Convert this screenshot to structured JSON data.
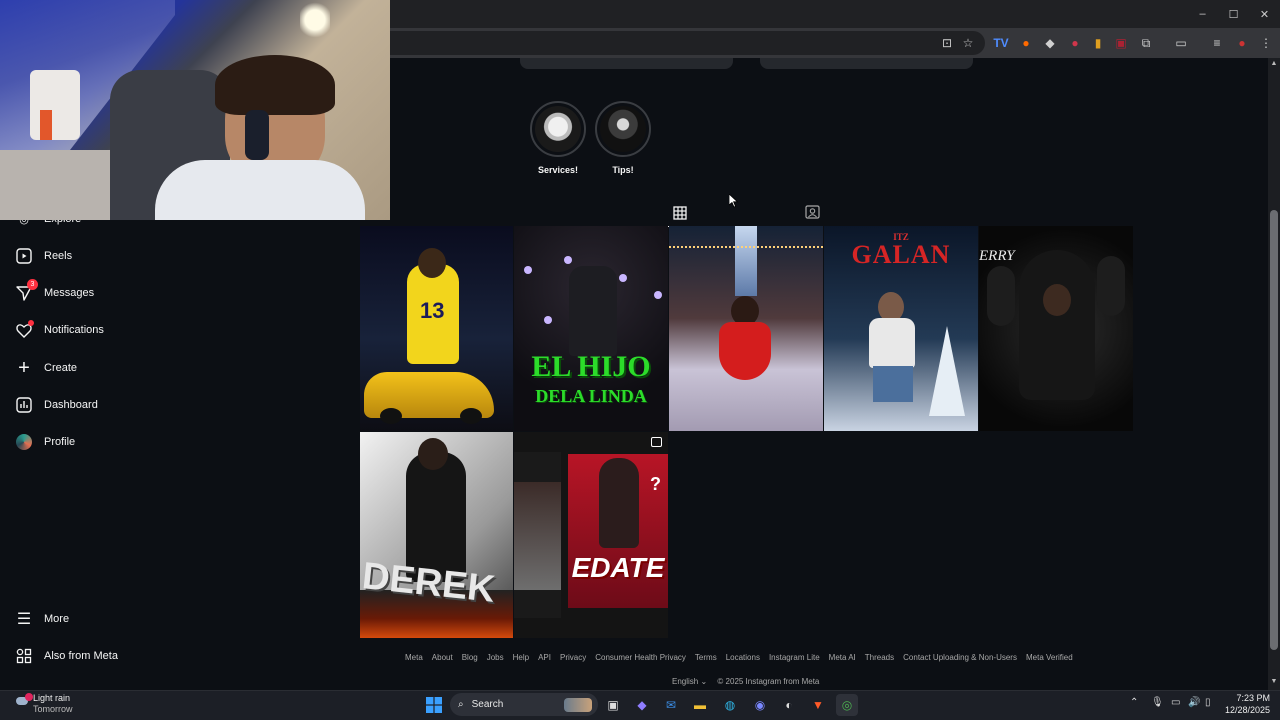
{
  "browser": {
    "window_controls": [
      "–",
      "☐",
      "✕"
    ]
  },
  "highlights": [
    {
      "label": "Services!"
    },
    {
      "label": "Tips!"
    }
  ],
  "sidebar": {
    "items": [
      {
        "label": "Explore",
        "icon": "compass-icon"
      },
      {
        "label": "Reels",
        "icon": "reels-icon"
      },
      {
        "label": "Messages",
        "icon": "messenger-icon",
        "badge": "3"
      },
      {
        "label": "Notifications",
        "icon": "heart-icon"
      },
      {
        "label": "Create",
        "icon": "plus-icon"
      },
      {
        "label": "Dashboard",
        "icon": "chart-icon"
      },
      {
        "label": "Profile",
        "icon": "avatar-icon"
      }
    ],
    "bottom": [
      {
        "label": "More",
        "icon": "menu-icon"
      },
      {
        "label": "Also from Meta",
        "icon": "meta-apps-icon"
      }
    ]
  },
  "posts": [
    {
      "name": "post-yellow-car",
      "text": "13"
    },
    {
      "name": "post-el-hijo",
      "text": "EL HIJO",
      "subtext": "DELA LINDA"
    },
    {
      "name": "post-red-dress",
      "text": ""
    },
    {
      "name": "post-itz-galan",
      "text": "ITZ",
      "subtext": "GALAN"
    },
    {
      "name": "post-hoodie",
      "text": "ERRY"
    },
    {
      "name": "post-derek",
      "text": "DEREK"
    },
    {
      "name": "post-edate",
      "text": "EDATE"
    }
  ],
  "footer": {
    "links": [
      "Meta",
      "About",
      "Blog",
      "Jobs",
      "Help",
      "API",
      "Privacy",
      "Consumer Health Privacy",
      "Terms",
      "Locations",
      "Instagram Lite",
      "Meta AI",
      "Threads",
      "Contact Uploading & Non-Users",
      "Meta Verified"
    ],
    "language": "English",
    "copyright": "© 2025 Instagram from Meta"
  },
  "taskbar": {
    "weather_title": "Light rain",
    "weather_sub": "Tomorrow",
    "search_placeholder": "Search",
    "time": "7:23 PM",
    "date": "12/28/2025"
  },
  "colors": {
    "background": "#0c0f14",
    "text": "#f5f5f5",
    "muted": "#a8a8a8",
    "badge": "#ff3040"
  }
}
